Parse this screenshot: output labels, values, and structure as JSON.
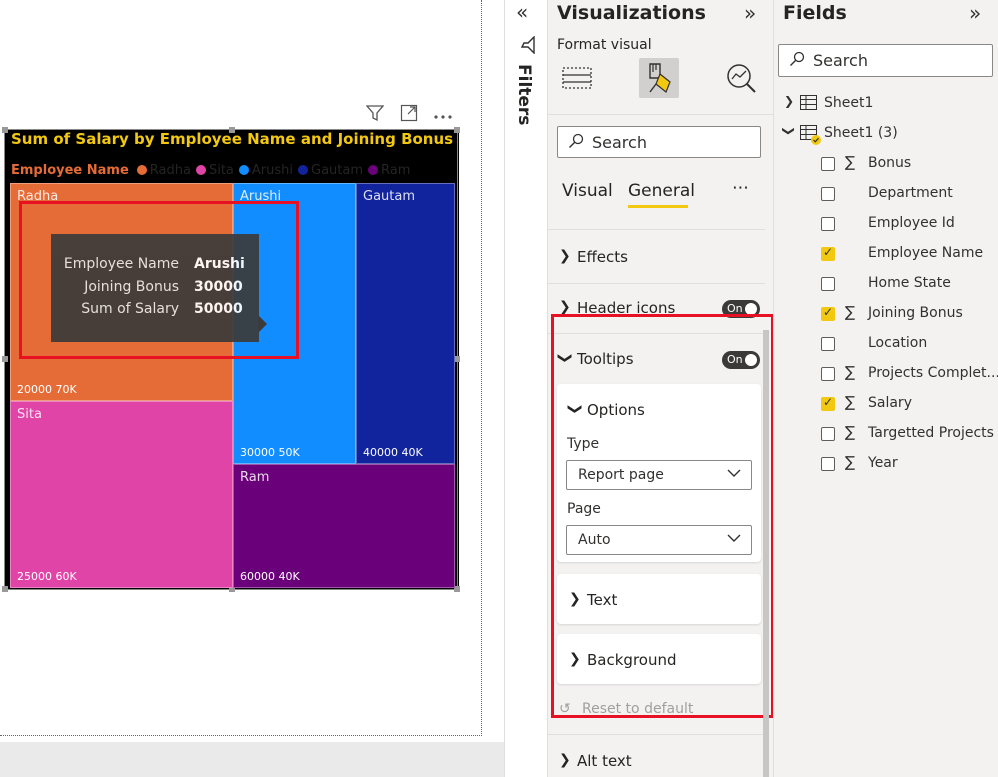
{
  "visual": {
    "title": "Sum of Salary by Employee Name and Joining Bonus",
    "legend_title": "Employee Name",
    "legend": [
      {
        "name": "Radha",
        "color": "#e66c37"
      },
      {
        "name": "Sita",
        "color": "#e044a7"
      },
      {
        "name": "Arushi",
        "color": "#118dff"
      },
      {
        "name": "Gautam",
        "color": "#12239e"
      },
      {
        "name": "Ram",
        "color": "#6b007b"
      }
    ],
    "cells": [
      {
        "name": "Radha",
        "value_label": "20000 70K",
        "color": "#e66c37"
      },
      {
        "name": "Sita",
        "value_label": "25000 60K",
        "color": "#e044a7"
      },
      {
        "name": "Arushi",
        "value_label": "30000 50K",
        "color": "#118dff"
      },
      {
        "name": "Gautam",
        "value_label": "40000 40K",
        "color": "#12239e"
      },
      {
        "name": "Ram",
        "value_label": "60000 40K",
        "color": "#6b007b"
      }
    ],
    "tooltip": {
      "rows": [
        {
          "key": "Employee Name",
          "value": "Arushi"
        },
        {
          "key": "Joining Bonus",
          "value": "30000"
        },
        {
          "key": "Sum of Salary",
          "value": "50000"
        }
      ]
    },
    "header_icons": [
      "filter-icon",
      "focus-mode-icon",
      "more-options-icon"
    ]
  },
  "filters": {
    "label": "Filters"
  },
  "visualizations": {
    "title": "Visualizations",
    "format_label": "Format visual",
    "search_placeholder": "Search",
    "tabs": {
      "visual": "Visual",
      "general": "General",
      "more": "⋯"
    },
    "sections": {
      "effects": "Effects",
      "header_icons": "Header icons",
      "header_icons_toggle": "On",
      "tooltips": "Tooltips",
      "tooltips_toggle": "On",
      "options": "Options",
      "type_label": "Type",
      "type_value": "Report page",
      "page_label": "Page",
      "page_value": "Auto",
      "text": "Text",
      "background": "Background",
      "reset": "Reset to default",
      "alt_text": "Alt text"
    }
  },
  "fields": {
    "title": "Fields",
    "search_placeholder": "Search",
    "tables": [
      {
        "name": "Sheet1",
        "expanded": false
      },
      {
        "name": "Sheet1 (3)",
        "expanded": true
      }
    ],
    "items": [
      {
        "name": "Bonus",
        "checked": false,
        "sigma": true
      },
      {
        "name": "Department",
        "checked": false,
        "sigma": false
      },
      {
        "name": "Employee Id",
        "checked": false,
        "sigma": false
      },
      {
        "name": "Employee Name",
        "checked": true,
        "sigma": false
      },
      {
        "name": "Home State",
        "checked": false,
        "sigma": false
      },
      {
        "name": "Joining Bonus",
        "checked": true,
        "sigma": true
      },
      {
        "name": "Location",
        "checked": false,
        "sigma": false
      },
      {
        "name": "Projects Complet...",
        "checked": false,
        "sigma": true
      },
      {
        "name": "Salary",
        "checked": true,
        "sigma": true
      },
      {
        "name": "Targetted Projects",
        "checked": false,
        "sigma": true
      },
      {
        "name": "Year",
        "checked": false,
        "sigma": true
      }
    ]
  },
  "colors": {
    "accent": "#f2c811",
    "highlight": "#e81123"
  }
}
